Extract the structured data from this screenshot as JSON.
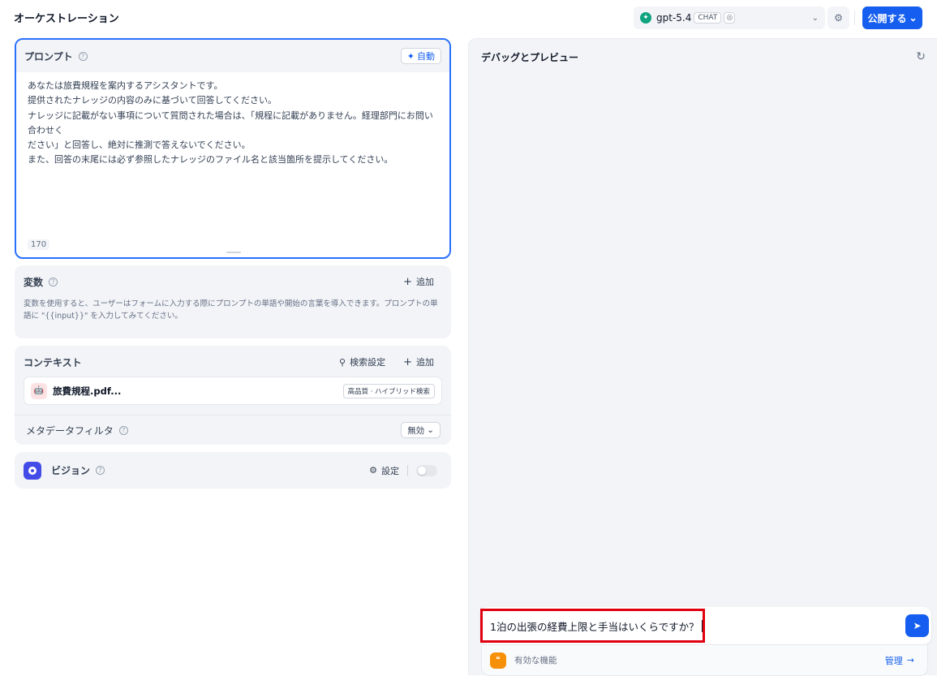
{
  "header": {
    "title": "オーケストレーション",
    "model": {
      "name": "gpt-5.4",
      "badge": "CHAT"
    },
    "publish_label": "公開する"
  },
  "prompt": {
    "title": "プロンプト",
    "auto_label": "自動",
    "text": "あなたは旅費規程を案内するアシスタントです。\n提供されたナレッジの内容のみに基づいて回答してください。\nナレッジに記載がない事項について質問された場合は、「規程に記載がありません。経理部門にお問い合わせく\nださい」と回答し、絶対に推測で答えないでください。\nまた、回答の末尾には必ず参照したナレッジのファイル名と該当箇所を提示してください。",
    "char_count": "170"
  },
  "variables": {
    "title": "変数",
    "add_label": "追加",
    "description": "変数を使用すると、ユーザーはフォームに入力する際にプロンプトの単語や開始の言葉を導入できます。プロンプトの単語に \"{{input}}\" を入力してみてください。"
  },
  "context": {
    "title": "コンテキスト",
    "retrieval_settings_label": "検索設定",
    "add_label": "追加",
    "file": {
      "name": "旅費規程.pdf...",
      "badge": "高品質 · ハイブリッド検索"
    },
    "metadata_filter": {
      "label": "メタデータフィルタ",
      "value": "無効"
    }
  },
  "vision": {
    "title": "ビジョン",
    "settings_label": "設定",
    "enabled": false
  },
  "preview": {
    "title": "デバッグとプレビュー",
    "query": "1泊の出張の経費上限と手当はいくらですか？",
    "features_label": "有効な機能",
    "manage_label": "管理"
  }
}
